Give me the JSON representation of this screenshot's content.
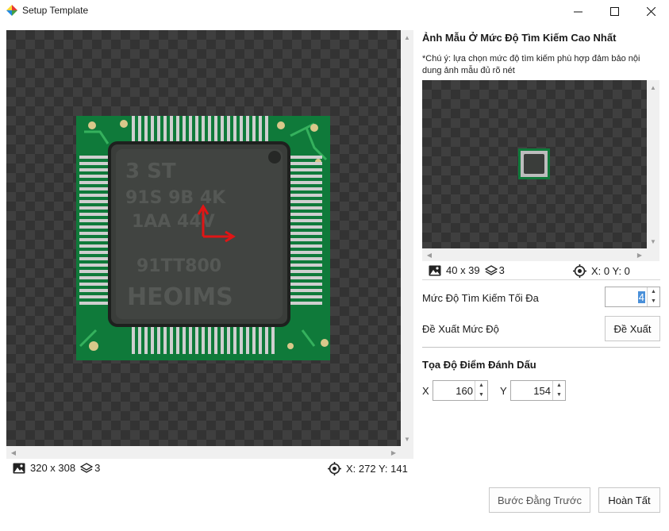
{
  "window": {
    "title": "Setup Template"
  },
  "main_view": {
    "size_text": "320 x 308",
    "layers": "3",
    "coord_text": "X: 272 Y: 141"
  },
  "right_panel": {
    "title": "Ảnh Mẫu Ở Mức Độ Tìm Kiếm Cao Nhất",
    "note": "*Chú ý: lựa chọn mức độ tìm kiếm phù hợp đảm bảo nội dung ảnh mẫu đủ rõ nét",
    "preview": {
      "size_text": "40 x 39",
      "layers": "3",
      "coord_text": "X: 0 Y: 0"
    },
    "max_level_label": "Mức Độ Tìm Kiếm Tối Đa",
    "max_level_value": "4",
    "suggest_label": "Đề Xuất Mức Độ",
    "suggest_button": "Đề Xuất",
    "marker_section_title": "Tọa Độ Điểm Đánh Dấu",
    "x_label": "X",
    "x_value": "160",
    "y_label": "Y",
    "y_value": "154"
  },
  "footer": {
    "back_button": "Bước Đằng Trước",
    "finish_button": "Hoàn Tất"
  },
  "colors": {
    "pcb_green": "#0f7a3a",
    "chip_body": "#3a3d3a",
    "marker_red": "#e01515",
    "selection_blue": "#4a90d9"
  }
}
